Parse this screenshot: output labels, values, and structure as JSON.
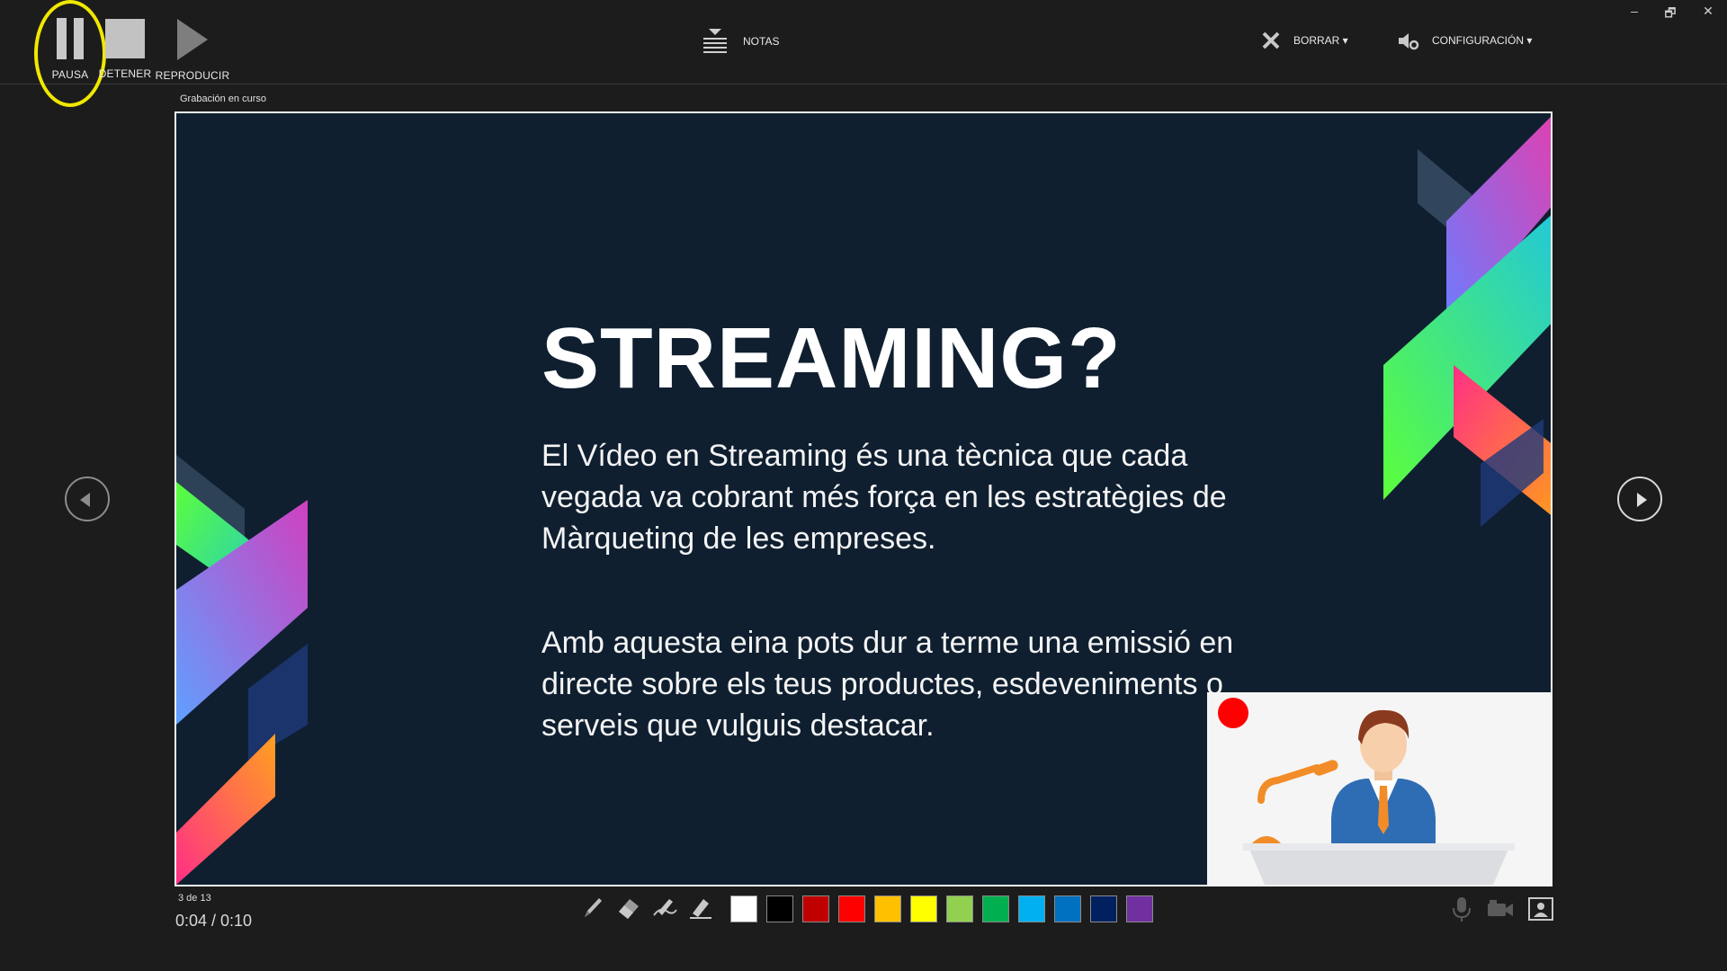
{
  "toolbar": {
    "pause_label": "PAUSA",
    "stop_label": "DETENER",
    "play_label": "REPRODUCIR",
    "notes_label": "NOTAS",
    "erase_label": "BORRAR ▾",
    "config_label": "CONFIGURACIÓN ▾"
  },
  "window": {
    "minimize": "–",
    "restore": "🗗",
    "close": "✕"
  },
  "status": {
    "recording": "Grabación en curso",
    "slide_counter": "3 de 13",
    "elapsed_total": "0:04  /  0:10"
  },
  "slide": {
    "title": "STREAMING?",
    "paragraph1": "El Vídeo en Streaming és una tècnica que cada vegada va cobrant més força en les estratègies de Màrqueting de les empreses.",
    "paragraph2": "Amb aquesta eina pots dur a terme una emissió en directe sobre els teus productes, esdeveniments o serveis que vulguis destacar."
  },
  "pen_tools": [
    "pen-icon",
    "eraser-icon",
    "highlighter-pen-icon",
    "marker-icon"
  ],
  "ink_colors": [
    "#ffffff",
    "#000000",
    "#c00000",
    "#ff0000",
    "#ffc000",
    "#ffff00",
    "#92d050",
    "#00b050",
    "#00b0f0",
    "#0070c0",
    "#002060",
    "#7030a0"
  ],
  "media_tools": [
    "microphone-icon",
    "camera-icon",
    "camera-preview-icon"
  ],
  "colors": {
    "highlight_ring": "#f0e800",
    "slide_background": "#0f1f30",
    "recording_dot": "#ff0000"
  }
}
